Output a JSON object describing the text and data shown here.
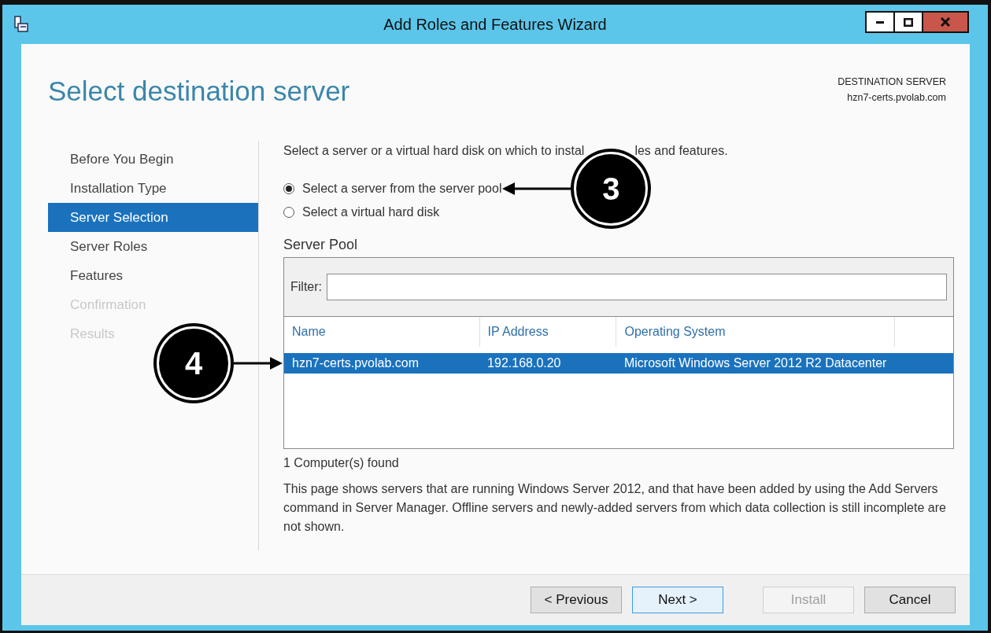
{
  "window": {
    "title": "Add Roles and Features Wizard"
  },
  "page": {
    "heading": "Select destination server",
    "destination_label": "DESTINATION SERVER",
    "destination_value": "hzn7-certs.pvolab.com"
  },
  "nav": [
    {
      "label": "Before You Begin",
      "selected": false,
      "disabled": false
    },
    {
      "label": "Installation Type",
      "selected": false,
      "disabled": false
    },
    {
      "label": "Server Selection",
      "selected": true,
      "disabled": false
    },
    {
      "label": "Server Roles",
      "selected": false,
      "disabled": false
    },
    {
      "label": "Features",
      "selected": false,
      "disabled": false
    },
    {
      "label": "Confirmation",
      "selected": false,
      "disabled": true
    },
    {
      "label": "Results",
      "selected": false,
      "disabled": true
    }
  ],
  "instruction": [
    "Select a server or a virtual hard disk on which to instal",
    "les and features."
  ],
  "radios": [
    {
      "label": "Select a server from the server pool",
      "selected": true,
      "callout": "3"
    },
    {
      "label": "Select a virtual hard disk",
      "selected": false
    }
  ],
  "server_pool": {
    "title": "Server Pool",
    "filter_label": "Filter:",
    "columns": [
      "Name",
      "IP Address",
      "Operating System"
    ],
    "rows": [
      {
        "cells": [
          "hzn7-certs.pvolab.com",
          "192.168.0.20",
          "Microsoft Windows Server 2012 R2 Datacenter"
        ],
        "selected": true,
        "callout": "4"
      }
    ]
  },
  "count": "1 Computer(s) found",
  "note": "This page shows servers that are running Windows Server 2012, and that have been added by using the Add Servers command in Server Manager. Offline servers and newly-added servers from which data collection is still incomplete are not shown.",
  "buttons": [
    {
      "label": "< Previous",
      "disabled": false,
      "focused": false
    },
    {
      "label": "Next >",
      "disabled": false,
      "focused": true
    },
    {
      "label": "Install",
      "disabled": true,
      "focused": false
    },
    {
      "label": "Cancel",
      "disabled": false,
      "focused": false
    }
  ]
}
